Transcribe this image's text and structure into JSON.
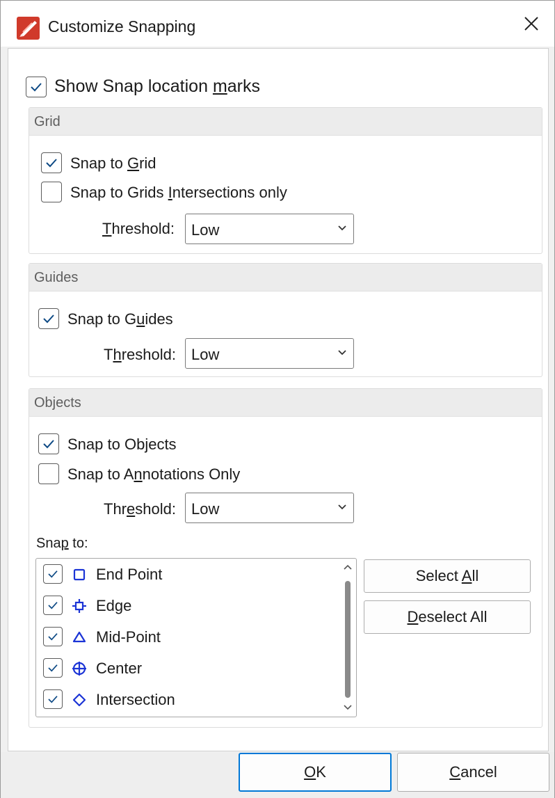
{
  "window": {
    "title": "Customize Snapping"
  },
  "show_marks": {
    "checked": true,
    "pre": "Show Snap location ",
    "u": "m",
    "post": "arks"
  },
  "grid": {
    "title": "Grid",
    "snap_to_grid": {
      "checked": true,
      "pre": "Snap to ",
      "u": "G",
      "post": "rid"
    },
    "intersections_only": {
      "checked": false,
      "pre": "Snap to Grids ",
      "u": "I",
      "post": "ntersections only"
    },
    "threshold": {
      "pre": "",
      "u": "T",
      "post": "hreshold:",
      "value": "Low"
    }
  },
  "guides": {
    "title": "Guides",
    "snap_to_guides": {
      "checked": true,
      "pre": "Snap to G",
      "u": "u",
      "post": "ides"
    },
    "threshold": {
      "pre": "T",
      "u": "h",
      "post": "reshold:",
      "value": "Low"
    }
  },
  "objects": {
    "title": "Objects",
    "snap_to_objects": {
      "checked": true,
      "pre": "Snap to Ob",
      "u": "j",
      "post": "ects"
    },
    "annotations_only": {
      "checked": false,
      "pre": "Snap to A",
      "u": "n",
      "post": "notations Only"
    },
    "threshold": {
      "pre": "Thr",
      "u": "e",
      "post": "shold:",
      "value": "Low"
    },
    "snap_to_label": {
      "pre": "Sna",
      "u": "p",
      "post": " to:"
    },
    "items": [
      {
        "label": "End Point",
        "checked": true,
        "icon": "square-icon"
      },
      {
        "label": "Edge",
        "checked": true,
        "icon": "edge-crosshair-icon"
      },
      {
        "label": "Mid-Point",
        "checked": true,
        "icon": "triangle-icon"
      },
      {
        "label": "Center",
        "checked": true,
        "icon": "circle-cross-icon"
      },
      {
        "label": "Intersection",
        "checked": true,
        "icon": "diamond-icon"
      }
    ],
    "select_all": {
      "pre": "Select ",
      "u": "A",
      "post": "ll"
    },
    "deselect_all": {
      "pre": "",
      "u": "D",
      "post": "eselect All"
    }
  },
  "footer": {
    "ok": {
      "pre": "",
      "u": "O",
      "post": "K"
    },
    "cancel": {
      "pre": "",
      "u": "C",
      "post": "ancel"
    }
  },
  "colors": {
    "check": "#0e4a85",
    "shape": "#1b34d6",
    "primary_border": "#0078d7",
    "app_icon": "#d03a2b"
  }
}
